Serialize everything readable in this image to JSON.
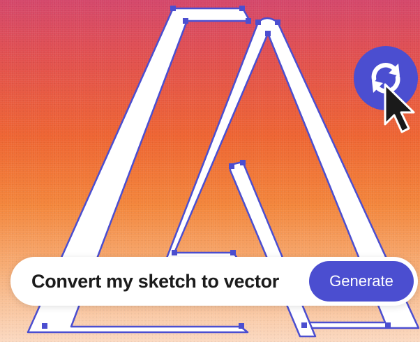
{
  "prompt": {
    "text": "Convert my sketch to vector"
  },
  "generate_button": {
    "label": "Generate"
  },
  "regenerate_button": {
    "icon": "refresh-icon"
  },
  "colors": {
    "accent": "#4b4ed0",
    "path_stroke": "#4b4ed0",
    "path_fill": "#ffffff"
  }
}
